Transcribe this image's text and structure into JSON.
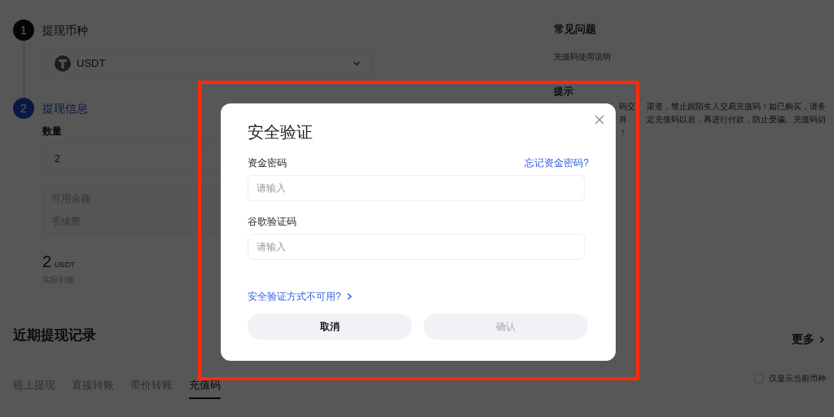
{
  "steps": [
    {
      "number": "1",
      "title": "提现币种",
      "active": false
    },
    {
      "number": "2",
      "title": "提现信息",
      "active": true
    }
  ],
  "currency_select": {
    "value": "USDT"
  },
  "amount": {
    "label": "数量",
    "value": "2"
  },
  "summary": [
    "可用余额",
    "手续费"
  ],
  "received": {
    "amount": "2",
    "unit": "USDT",
    "label": "实际到账"
  },
  "history": {
    "title": "近期提现记录",
    "more": "更多",
    "tabs": [
      {
        "label": "链上提现",
        "selected": false
      },
      {
        "label": "直接转账",
        "selected": false
      },
      {
        "label": "带价转账",
        "selected": false
      },
      {
        "label": "充值码",
        "selected": true
      }
    ],
    "filter": {
      "label": "仅显示当前币种",
      "checked": false
    }
  },
  "faq": {
    "title": "常见问题",
    "link": "充值码使用说明",
    "tip_title": "提示",
    "tip_lines": [
      {
        "left": "码交",
        "right": "渠道，禁止跟陌生人交易充值码！如已购买，请务"
      },
      {
        "left": "并",
        "right": "定充值码以后，再进行付款，防止受骗。充值码切"
      },
      {
        "left": "！"
      }
    ]
  },
  "dialog": {
    "title": "安全验证",
    "fields": [
      {
        "label": "资金密码",
        "link": "忘记资金密码?",
        "placeholder": "请输入"
      },
      {
        "label": "谷歌验证码",
        "placeholder": "请输入"
      }
    ],
    "alt_link": "安全验证方式不可用?",
    "buttons": [
      {
        "label": "取消",
        "disabled": false
      },
      {
        "label": "确认",
        "disabled": true
      }
    ]
  },
  "highlight": {
    "shown": true
  }
}
